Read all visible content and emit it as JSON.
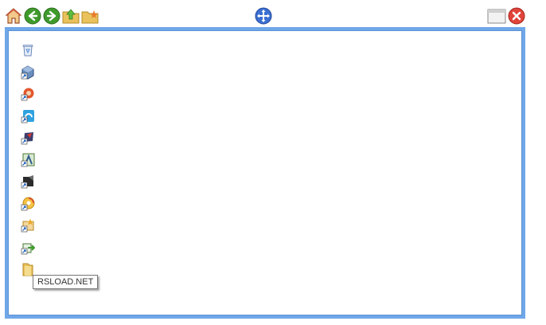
{
  "toolbar": {
    "buttons": [
      {
        "name": "home",
        "icon": "home-icon"
      },
      {
        "name": "back",
        "icon": "arrow-left-icon"
      },
      {
        "name": "forward",
        "icon": "arrow-right-icon"
      },
      {
        "name": "up-folder",
        "icon": "folder-up-icon"
      },
      {
        "name": "favorite-folder",
        "icon": "folder-star-icon"
      }
    ],
    "move_icon": "move-icon",
    "window_icon": "window-icon",
    "close_icon": "close-icon"
  },
  "items": [
    {
      "icon": "recycle-bin-icon"
    },
    {
      "icon": "cube-shortcut-icon"
    },
    {
      "icon": "flame-shortcut-icon"
    },
    {
      "icon": "browser-shortcut-icon"
    },
    {
      "icon": "media-shortcut-icon"
    },
    {
      "icon": "image-shortcut-icon"
    },
    {
      "icon": "editor-shortcut-icon"
    },
    {
      "icon": "disc-shortcut-icon"
    },
    {
      "icon": "star-shortcut-icon"
    },
    {
      "icon": "export-shortcut-icon"
    },
    {
      "icon": "folder-icon"
    }
  ],
  "tooltip": {
    "text": "RSLOAD.NET"
  },
  "colors": {
    "panel_border": "#6fa7e8",
    "accent_green": "#3f9a2c",
    "close_red": "#e0443a"
  }
}
